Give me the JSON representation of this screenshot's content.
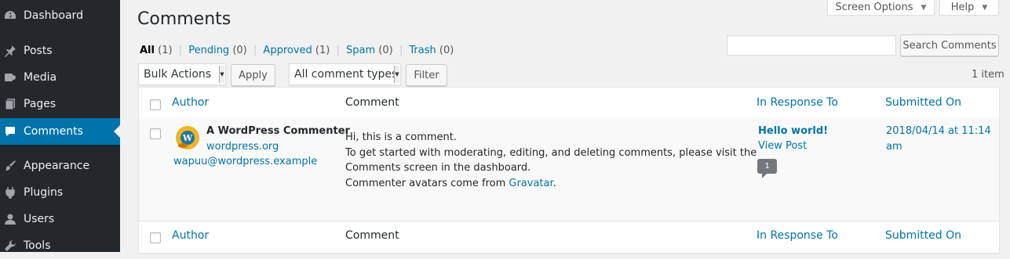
{
  "sidebar": {
    "items": [
      {
        "label": "Dashboard",
        "icon": "dashboard-icon"
      },
      {
        "label": "Posts",
        "icon": "pin-icon"
      },
      {
        "label": "Media",
        "icon": "media-icon"
      },
      {
        "label": "Pages",
        "icon": "pages-icon"
      },
      {
        "label": "Comments",
        "icon": "comment-icon",
        "current": true
      },
      {
        "label": "Appearance",
        "icon": "paintbrush-icon"
      },
      {
        "label": "Plugins",
        "icon": "plugin-icon"
      },
      {
        "label": "Users",
        "icon": "user-icon"
      },
      {
        "label": "Tools",
        "icon": "wrench-icon"
      }
    ],
    "current_color": "#0073aa"
  },
  "header": {
    "title": "Comments",
    "screen_options": "Screen Options",
    "help": "Help"
  },
  "filters": {
    "all": {
      "label": "All",
      "count": "(1)"
    },
    "pending": {
      "label": "Pending",
      "count": "(0)"
    },
    "approved": {
      "label": "Approved",
      "count": "(1)"
    },
    "spam": {
      "label": "Spam",
      "count": "(0)"
    },
    "trash": {
      "label": "Trash",
      "count": "(0)"
    },
    "separator": "|"
  },
  "search": {
    "value": "",
    "button": "Search Comments"
  },
  "toolbar": {
    "bulk_actions": "Bulk Actions",
    "apply": "Apply",
    "comment_types": "All comment types",
    "filter": "Filter",
    "items_count": "1 item"
  },
  "table": {
    "columns": {
      "author": "Author",
      "comment": "Comment",
      "in_response_to": "In Response To",
      "submitted_on": "Submitted On"
    },
    "row": {
      "author_name": "A WordPress Commenter",
      "author_url": "wordpress.org",
      "author_email": "wapuu@wordpress.example",
      "comment_lines": [
        "Hi, this is a comment.",
        "To get started with moderating, editing, and deleting comments, please visit the",
        "Comments screen in the dashboard."
      ],
      "comment_last_prefix": "Commenter avatars come from ",
      "comment_last_link": "Gravatar",
      "comment_last_suffix": ".",
      "response_post": "Hello world!",
      "view_post": "View Post",
      "comment_count": "1",
      "submitted_line1": "2018/04/14 at 11:14",
      "submitted_line2": "am"
    }
  }
}
